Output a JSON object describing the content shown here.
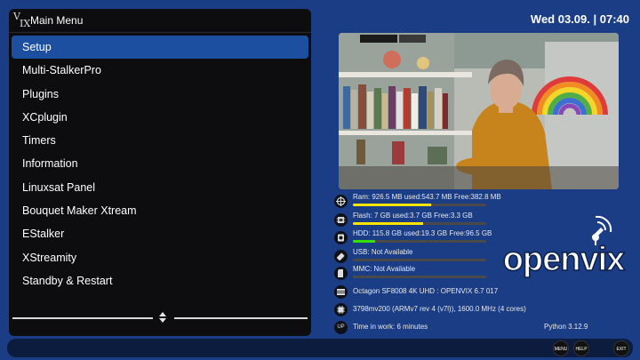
{
  "header": {
    "title": "Main Menu",
    "logo_text_v": "V",
    "logo_text_ix": "IX"
  },
  "clock": {
    "text": "Wed 03.09.  |  07:40"
  },
  "menu": {
    "items": [
      {
        "label": "Setup",
        "selected": true
      },
      {
        "label": "Multi-StalkerPro"
      },
      {
        "label": "Plugins"
      },
      {
        "label": "XCplugin"
      },
      {
        "label": "Timers"
      },
      {
        "label": "Information"
      },
      {
        "label": "Linuxsat Panel"
      },
      {
        "label": "Bouquet Maker Xtream"
      },
      {
        "label": "EStalker"
      },
      {
        "label": "XStreamity"
      },
      {
        "label": "Standby & Restart"
      }
    ]
  },
  "info": {
    "ram": {
      "label": "Ram: 926.5 MB used:543.7 MB Free:382.8 MB",
      "used_fraction": 0.587,
      "icon": "memory-icon"
    },
    "flash": {
      "label": "Flash: 7 GB used:3.7 GB Free:3.3 GB",
      "used_fraction": 0.529,
      "icon": "chip-icon"
    },
    "hdd": {
      "label": "HDD: 115.8 GB used:19.3 GB Free:96.5 GB",
      "used_fraction": 0.167,
      "icon": "hdd-icon"
    },
    "usb": {
      "label": "USB: Not Available",
      "icon": "usb-icon"
    },
    "mmc": {
      "label": "MMC: Not Available",
      "icon": "sdcard-icon"
    },
    "model": {
      "text": "Octagon SF8008 4K UHD : OPENVIX 6.7 017",
      "icon": "receiver-icon"
    },
    "cpu": {
      "text": "3798mv200 (ARMv7 rev 4 (v7l)), 1600.0 MHz (4 cores)",
      "icon": "cpu-icon"
    },
    "uptime": {
      "text": "Time in work: 6 minutes",
      "icon_text": "UP"
    },
    "python": {
      "text": "Python 3.12.9"
    }
  },
  "logo": {
    "text": "openvix"
  },
  "buttons": {
    "menu": "MENU",
    "help": "HELP",
    "exit": "EXIT"
  },
  "colors": {
    "background": "#1a3d86",
    "selection": "#1c4fa0",
    "bar_green": "#36e100",
    "bar_yellow": "#ffe400"
  }
}
